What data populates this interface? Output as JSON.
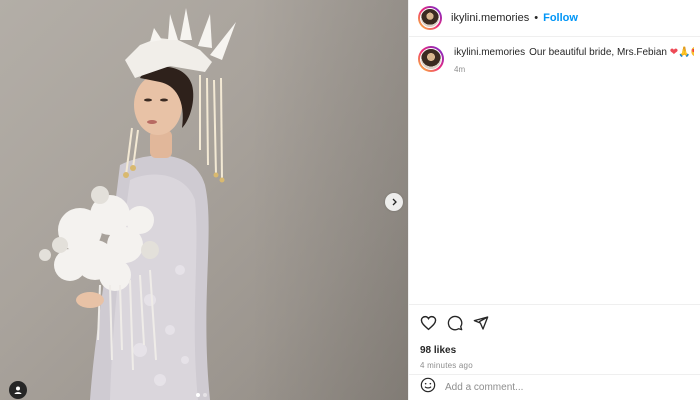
{
  "post": {
    "username": "ikylini.memories",
    "follow_label": "Follow",
    "separator": "•",
    "caption_text": "Our beautiful bride, Mrs.Febian",
    "caption_emojis": "❤🙏😍",
    "caption_time": "4m",
    "likes": "98 likes",
    "posted_ago": "4 minutes ago",
    "comment_placeholder": "Add a comment..."
  },
  "carousel": {
    "total_slides": 2,
    "current_slide": 1
  },
  "icons": {
    "like": "heart-icon",
    "comment": "comment-icon",
    "share": "paper-plane-icon",
    "emoji": "smiley-icon",
    "next": "chevron-right-icon",
    "tagged": "user-tag-icon"
  },
  "colors": {
    "follow": "#0095f6",
    "emoji_heart": "#ed4956",
    "muted": "#8e8e8e"
  }
}
